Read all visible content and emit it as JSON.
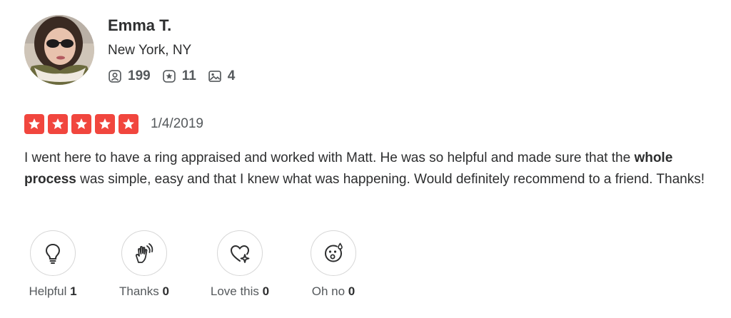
{
  "user": {
    "name": "Emma T.",
    "location": "New York, NY",
    "stats": {
      "friends": "199",
      "reviews": "11",
      "photos": "4"
    }
  },
  "review": {
    "rating": 5,
    "date": "1/4/2019",
    "text_before": "I went here to have a ring appraised and worked with Matt. He was so helpful and made sure that the ",
    "text_bold": "whole process",
    "text_after": " was simple, easy and that I knew what was happening. Would definitely recommend to a friend. Thanks!"
  },
  "reactions": {
    "helpful": {
      "label": "Helpful",
      "count": "1",
      "icon": "lightbulb-icon"
    },
    "thanks": {
      "label": "Thanks",
      "count": "0",
      "icon": "clapping-hands-icon"
    },
    "love": {
      "label": "Love this",
      "count": "0",
      "icon": "heart-sparkle-icon"
    },
    "ohno": {
      "label": "Oh no",
      "count": "0",
      "icon": "surprised-face-icon"
    }
  },
  "colors": {
    "star_red": "#f1463e",
    "text": "#2d2e2f",
    "muted": "#55595c"
  }
}
